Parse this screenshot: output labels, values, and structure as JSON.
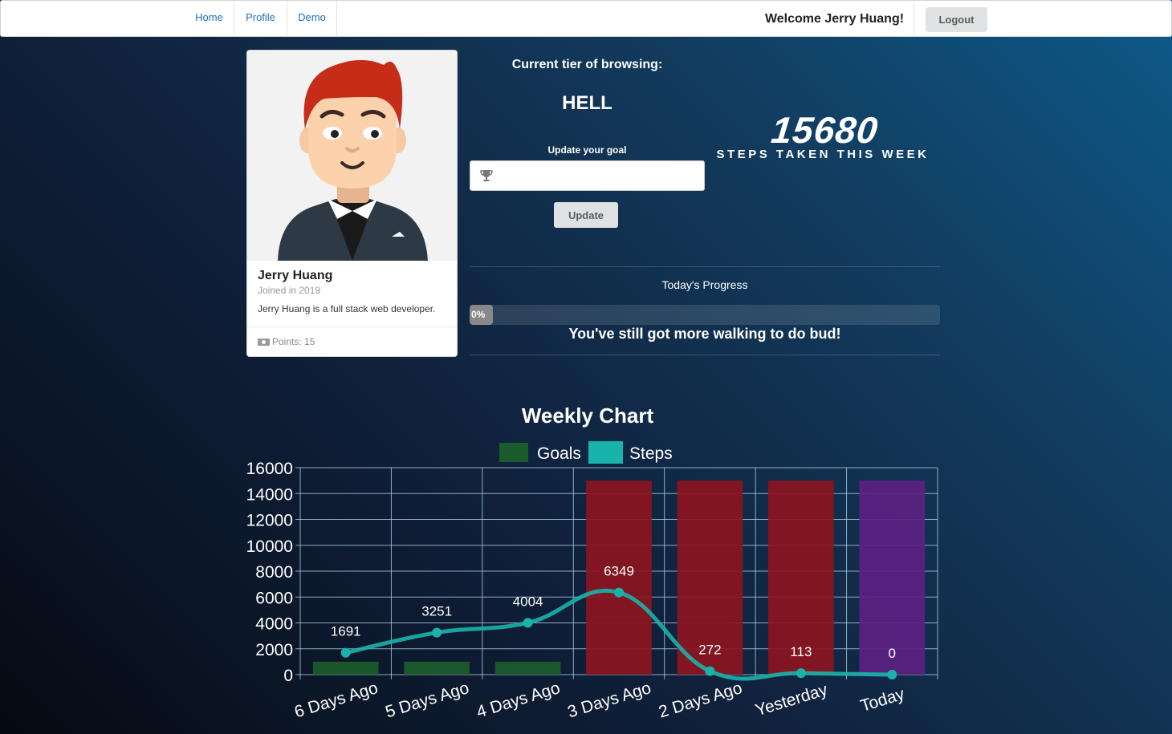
{
  "nav": {
    "items": [
      {
        "label": "Home"
      },
      {
        "label": "Profile"
      },
      {
        "label": "Demo"
      }
    ],
    "welcome": "Welcome Jerry Huang!",
    "logout_label": "Logout"
  },
  "profile": {
    "name": "Jerry Huang",
    "meta": "Joined in 2019",
    "description": "Jerry Huang is a full stack web developer.",
    "points": "Points: 15",
    "avatar_icon": "avatar-cartoon-man"
  },
  "tier": {
    "label": "Current tier of browsing:",
    "value": "HELL"
  },
  "goal": {
    "label": "Update your goal",
    "value": "",
    "placeholder": "",
    "icon": "trophy-icon",
    "button_label": "Update"
  },
  "stats": {
    "steps_value": "15680",
    "steps_label": "STEPS TAKEN THIS WEEK"
  },
  "progress": {
    "title": "Today's Progress",
    "percent": 0,
    "percent_label": "0%",
    "message": "You've still got more walking to do bud!"
  },
  "colors": {
    "goal_bar": "#1c5c2c",
    "goal_bar_missed": "#8b1520",
    "goal_bar_today": "#5c2182",
    "steps_line": "#1ab3ab"
  },
  "chart_data": {
    "type": "bar",
    "title": "Weekly Chart",
    "categories": [
      "6 Days Ago",
      "5 Days Ago",
      "4 Days Ago",
      "3 Days Ago",
      "2 Days Ago",
      "Yesterday",
      "Today"
    ],
    "series": [
      {
        "name": "Goals",
        "type": "bar",
        "values": [
          1000,
          1000,
          1000,
          15000,
          15000,
          15000,
          15000
        ]
      },
      {
        "name": "Steps",
        "type": "line",
        "values": [
          1691,
          3251,
          4004,
          6349,
          272,
          113,
          0
        ]
      }
    ],
    "ylim": [
      0,
      16000
    ],
    "yticks": [
      "0",
      "2000",
      "4000",
      "6000",
      "8000",
      "10000",
      "12000",
      "14000",
      "16000"
    ],
    "grid": true,
    "legend": "top"
  }
}
